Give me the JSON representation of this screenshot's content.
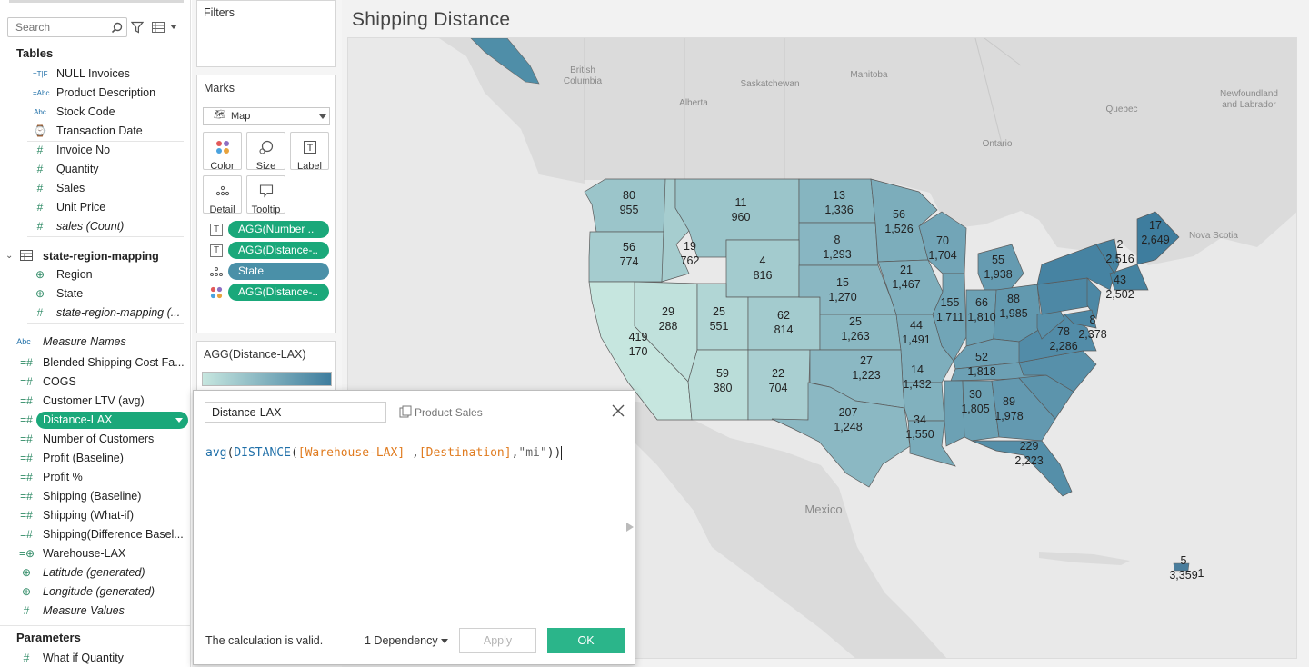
{
  "data_pane": {
    "search_placeholder": "Search",
    "tables_title": "Tables",
    "fields_main": [
      {
        "label": "NULL Invoices",
        "icon": "=T|F",
        "icon_name": "calc-boolean-icon",
        "italic": false
      },
      {
        "label": "Product Description",
        "icon": "=Abc",
        "icon_name": "calc-string-icon",
        "italic": false
      },
      {
        "label": "Stock Code",
        "icon": "Abc",
        "icon_name": "string-icon",
        "italic": false
      },
      {
        "label": "Transaction Date",
        "icon": "⌚",
        "icon_name": "date-icon",
        "italic": false
      },
      {
        "label": "Invoice No",
        "icon": "#",
        "icon_name": "number-icon",
        "italic": false
      },
      {
        "label": "Quantity",
        "icon": "#",
        "icon_name": "number-icon",
        "italic": false
      },
      {
        "label": "Sales",
        "icon": "#",
        "icon_name": "number-icon",
        "italic": false
      },
      {
        "label": "Unit Price",
        "icon": "#",
        "icon_name": "number-icon",
        "italic": false
      },
      {
        "label": "sales (Count)",
        "icon": "#",
        "icon_name": "number-icon",
        "italic": true
      }
    ],
    "mapping_table": "state-region-mapping",
    "fields_mapping": [
      {
        "label": "Region",
        "icon": "⊕",
        "icon_name": "globe-icon",
        "italic": false
      },
      {
        "label": "State",
        "icon": "⊕",
        "icon_name": "globe-icon",
        "italic": false
      },
      {
        "label": "state-region-mapping (...",
        "icon": "#",
        "icon_name": "number-icon",
        "italic": true
      }
    ],
    "measure_names": "Measure Names",
    "measures": [
      {
        "label": "Blended Shipping Cost Fa...",
        "icon": "=#",
        "icon_name": "calc-number-icon",
        "italic": false
      },
      {
        "label": "COGS",
        "icon": "=#",
        "icon_name": "calc-number-icon",
        "italic": false
      },
      {
        "label": "Customer LTV (avg)",
        "icon": "=#",
        "icon_name": "calc-number-icon",
        "italic": false
      },
      {
        "label": "Distance-LAX",
        "icon": "=#",
        "icon_name": "calc-number-icon",
        "italic": false,
        "selected": true
      },
      {
        "label": "Number of Customers",
        "icon": "=#",
        "icon_name": "calc-number-icon",
        "italic": false
      },
      {
        "label": "Profit (Baseline)",
        "icon": "=#",
        "icon_name": "calc-number-icon",
        "italic": false
      },
      {
        "label": "Profit %",
        "icon": "=#",
        "icon_name": "calc-number-icon",
        "italic": false
      },
      {
        "label": "Shipping (Baseline)",
        "icon": "=#",
        "icon_name": "calc-number-icon",
        "italic": false
      },
      {
        "label": "Shipping (What-if)",
        "icon": "=#",
        "icon_name": "calc-number-icon",
        "italic": false
      },
      {
        "label": "Shipping(Difference Basel...",
        "icon": "=#",
        "icon_name": "calc-number-icon",
        "italic": false
      },
      {
        "label": "Warehouse-LAX",
        "icon": "=⊕",
        "icon_name": "calc-geo-icon",
        "italic": false
      },
      {
        "label": "Latitude (generated)",
        "icon": "⊕",
        "icon_name": "globe-icon",
        "italic": true
      },
      {
        "label": "Longitude (generated)",
        "icon": "⊕",
        "icon_name": "globe-icon",
        "italic": true
      },
      {
        "label": "Measure Values",
        "icon": "#",
        "icon_name": "number-icon",
        "italic": true
      }
    ],
    "parameters_title": "Parameters",
    "parameters": [
      {
        "label": "What if Quantity",
        "icon": "#",
        "icon_name": "number-icon",
        "italic": false
      }
    ]
  },
  "shelves": {
    "filters_title": "Filters",
    "marks_title": "Marks",
    "mark_type": "Map",
    "mark_buttons": [
      {
        "label": "Color",
        "icon_name": "color-icon"
      },
      {
        "label": "Size",
        "icon_name": "size-icon"
      },
      {
        "label": "Label",
        "icon_name": "label-icon"
      },
      {
        "label": "Detail",
        "icon_name": "detail-icon"
      },
      {
        "label": "Tooltip",
        "icon_name": "tooltip-icon"
      }
    ],
    "pills": [
      {
        "label": "AGG(Number ..",
        "type": "label",
        "color": "#1aa87a"
      },
      {
        "label": "AGG(Distance-..",
        "type": "label",
        "color": "#1aa87a"
      },
      {
        "label": "State",
        "type": "detail",
        "color": "#4a90a8"
      },
      {
        "label": "AGG(Distance-..",
        "type": "color",
        "color": "#1aa87a"
      }
    ],
    "legend_title": "AGG(Distance-LAX)",
    "legend_colors": [
      "#c6e6df",
      "#3e7d9e"
    ]
  },
  "viz": {
    "title": "Shipping Distance",
    "place_labels": [
      "British Columbia",
      "Alberta",
      "Saskatchewan",
      "Manitoba",
      "Ontario",
      "Quebec",
      "Newfoundland and Labrador",
      "Nova Scotia",
      "Mexico"
    ],
    "state_labels": [
      {
        "top": "80",
        "bottom": "955"
      },
      {
        "top": "56",
        "bottom": "774"
      },
      {
        "top": "11",
        "bottom": "960"
      },
      {
        "top": "13",
        "bottom": "1,336"
      },
      {
        "top": "19",
        "bottom": "762"
      },
      {
        "top": "8",
        "bottom": "1,293"
      },
      {
        "top": "56",
        "bottom": "1,526"
      },
      {
        "top": "70",
        "bottom": "1,704"
      },
      {
        "top": "4",
        "bottom": "816"
      },
      {
        "top": "17",
        "bottom": "2,649"
      },
      {
        "top": "2",
        "bottom": "2,516"
      },
      {
        "top": "55",
        "bottom": "1,938"
      },
      {
        "top": "21",
        "bottom": "1,467"
      },
      {
        "top": "15",
        "bottom": "1,270"
      },
      {
        "top": "43",
        "bottom": "2,502"
      },
      {
        "top": "29",
        "bottom": "288"
      },
      {
        "top": "25",
        "bottom": "551"
      },
      {
        "top": "62",
        "bottom": "814"
      },
      {
        "top": "155",
        "bottom": "1,711"
      },
      {
        "top": "66",
        "bottom": "1,810"
      },
      {
        "top": "88",
        "bottom": "1,985"
      },
      {
        "top": "25",
        "bottom": "1,263"
      },
      {
        "top": "44",
        "bottom": "1,491"
      },
      {
        "top": "419",
        "bottom": "170"
      },
      {
        "top": "78",
        "bottom": "2,286"
      },
      {
        "top": "8",
        "bottom": "2,378"
      },
      {
        "top": "52",
        "bottom": "1,818"
      },
      {
        "top": "27",
        "bottom": "1,223"
      },
      {
        "top": "59",
        "bottom": "380"
      },
      {
        "top": "22",
        "bottom": "704"
      },
      {
        "top": "14",
        "bottom": "1,432"
      },
      {
        "top": "30",
        "bottom": "1,805"
      },
      {
        "top": "89",
        "bottom": "1,978"
      },
      {
        "top": "207",
        "bottom": "1,248"
      },
      {
        "top": "34",
        "bottom": "1,550"
      },
      {
        "top": "229",
        "bottom": "2,223"
      },
      {
        "top": "5",
        "bottom": "3,359"
      },
      {
        "top": "",
        "bottom": "1"
      }
    ],
    "colors": {
      "land": "#d9d9d9",
      "water": "#e9e9e9",
      "ramp_low": "#c6e6df",
      "ramp_high": "#3e7d9e"
    }
  },
  "calc_editor": {
    "name": "Distance-LAX",
    "source": "Product Sales",
    "formula": {
      "fn1": "avg",
      "fn2": "DISTANCE",
      "arg1": "[Warehouse-LAX]",
      "arg2": "[Destination]",
      "arg3": "\"mi\""
    },
    "status": "The calculation is valid.",
    "dependency": "1 Dependency",
    "apply": "Apply",
    "ok": "OK"
  }
}
